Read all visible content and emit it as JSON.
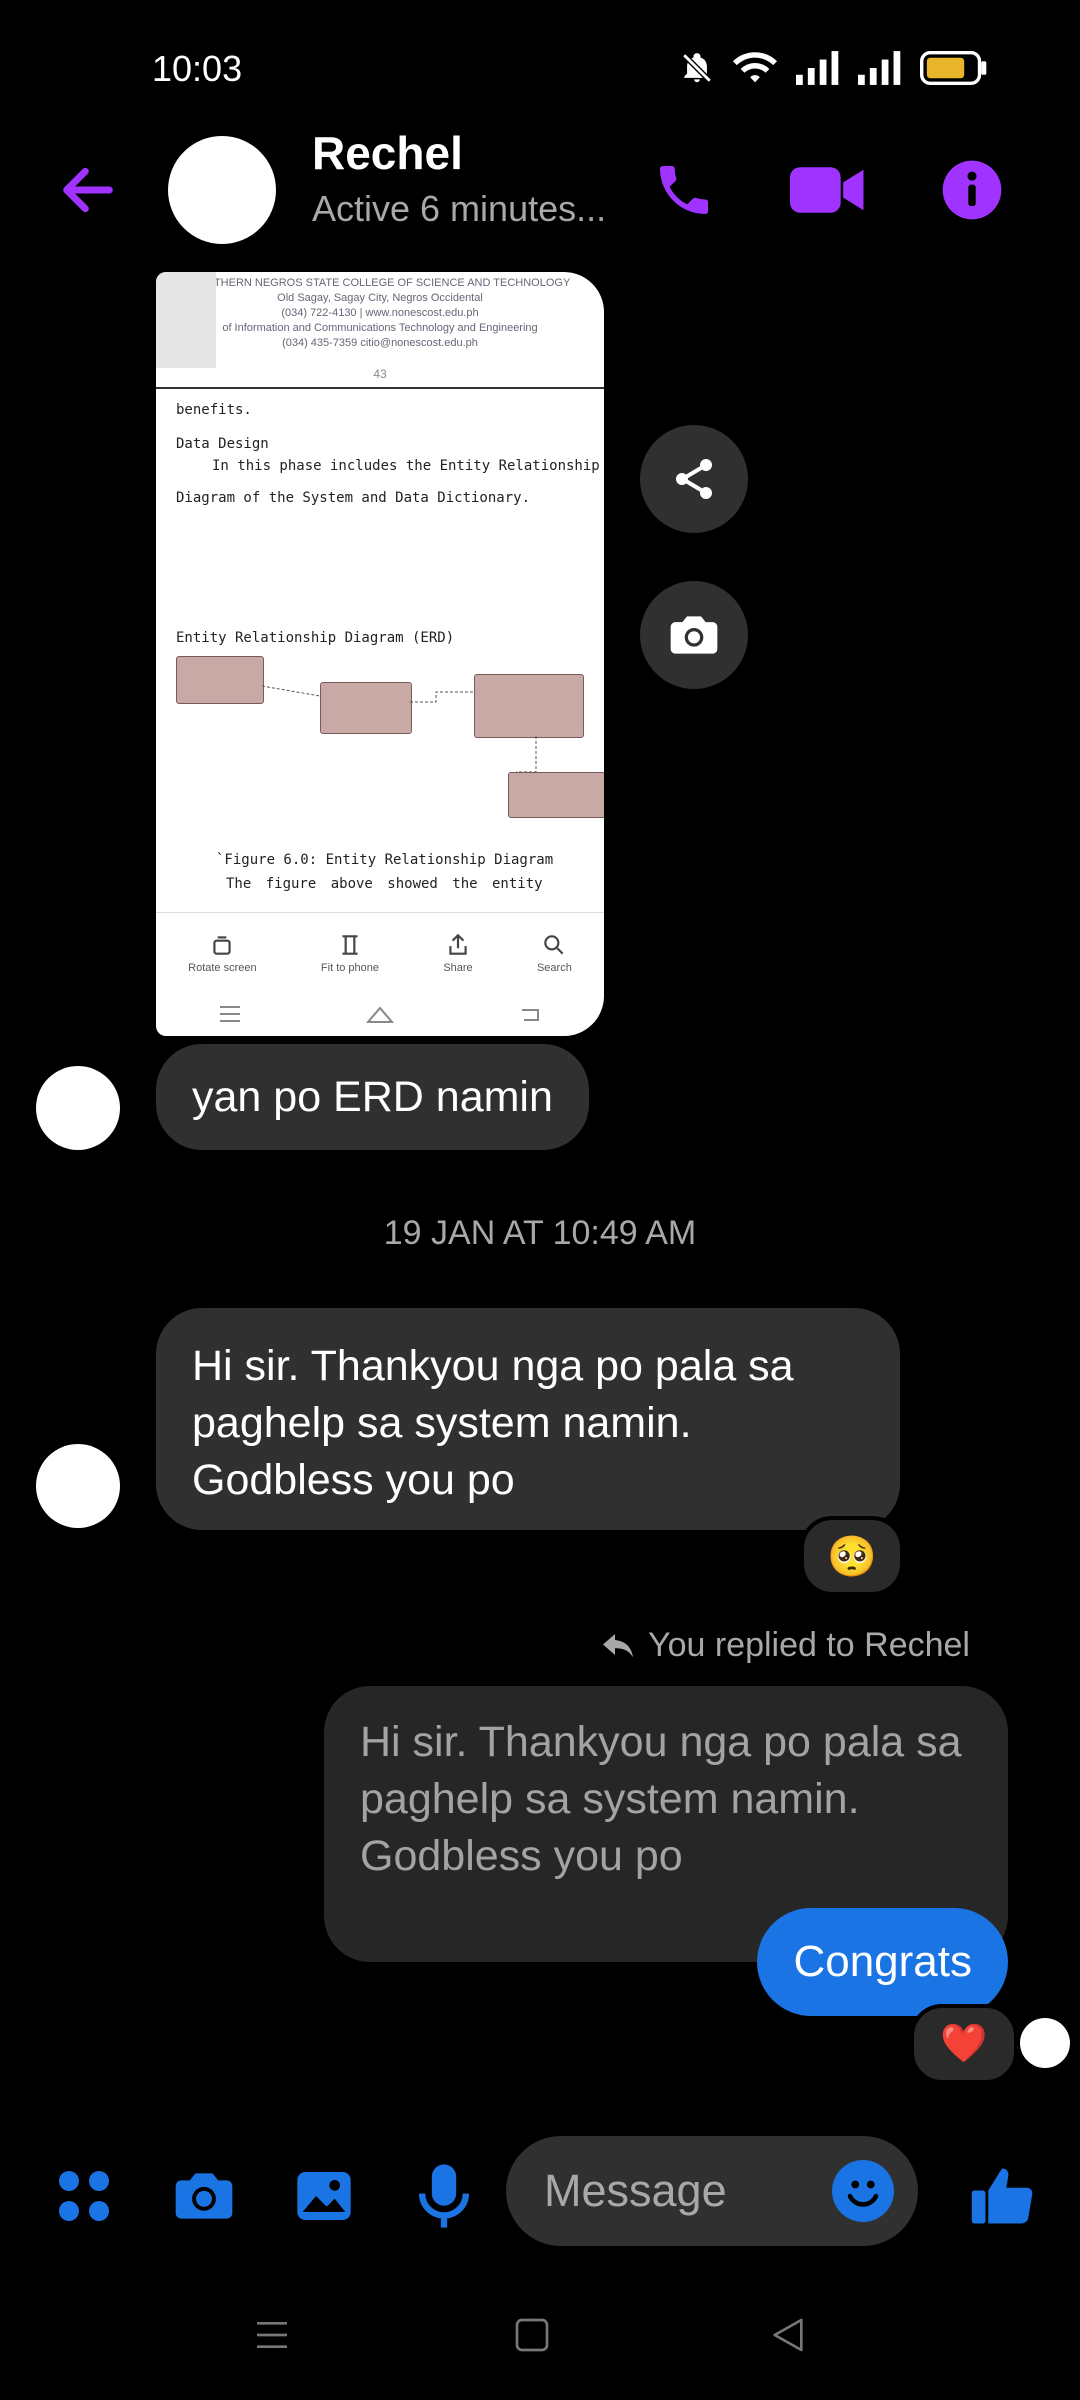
{
  "status": {
    "time": "10:03"
  },
  "header": {
    "name": "Rechel",
    "presence": "Active 6 minutes..."
  },
  "doc": {
    "header_lines": [
      "NORTHERN NEGROS STATE COLLEGE OF SCIENCE AND TECHNOLOGY",
      "Old Sagay, Sagay City, Negros Occidental",
      "(034) 722-4130 | www.nonescost.edu.ph",
      "of Information and Communications Technology and Engineering",
      "(034) 435-7359 citio@nonescost.edu.ph"
    ],
    "page_number": "43",
    "line1": "benefits.",
    "line2": "Data Design",
    "line3": "In this phase includes the Entity Relationship",
    "line4": "Diagram of the System and Data Dictionary.",
    "line5": "Entity Relationship Diagram (ERD)",
    "caption": "`Figure 6.0: Entity Relationship Diagram",
    "line6": "The  figure  above  showed  the  entity",
    "toolbar": {
      "rotate": "Rotate screen",
      "fit": "Fit to phone",
      "share": "Share",
      "search": "Search"
    }
  },
  "messages": {
    "erd_msg": "yan po ERD namin",
    "timestamp": "19 JAN AT 10:49 AM",
    "thanks_msg": "Hi sir. Thankyou nga po pala sa paghelp sa system namin. Godbless you po",
    "thanks_reaction": "🥺",
    "replied_label": "You replied to Rechel",
    "quoted_text": "Hi sir. Thankyou nga po pala sa paghelp sa system namin. Godbless you po",
    "reply_msg": "Congrats",
    "reply_reaction": "❤️"
  },
  "composer": {
    "placeholder": "Message"
  },
  "colors": {
    "accent_purple": "#a033ff",
    "messenger_blue": "#1b74e4",
    "bubble_gray": "#303030"
  }
}
